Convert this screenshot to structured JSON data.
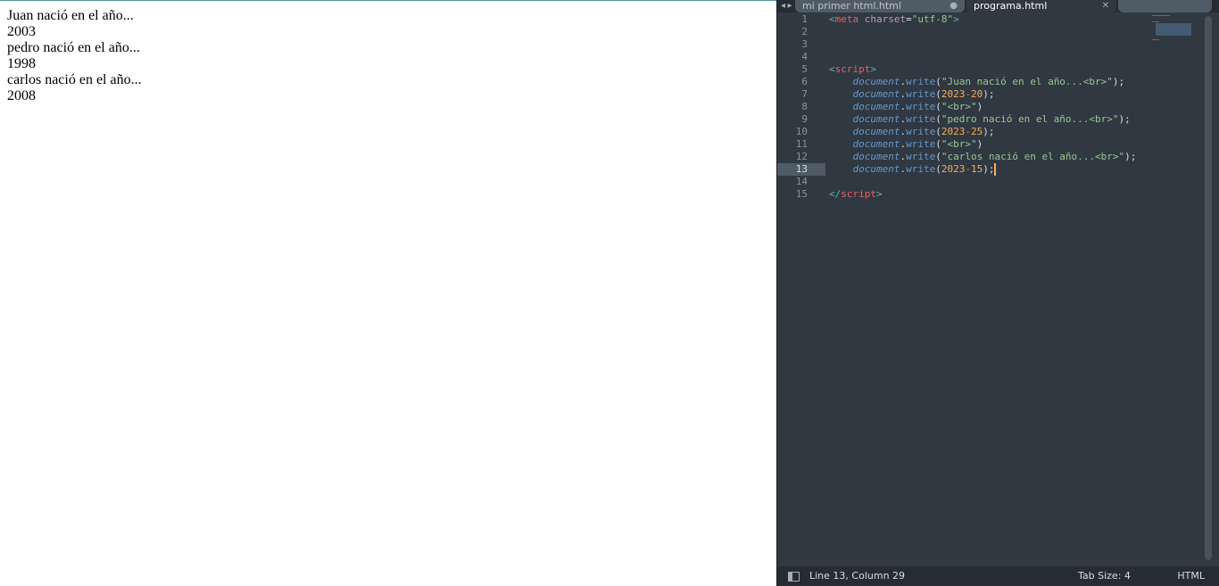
{
  "output_lines": [
    "Juan nació en el año...",
    "2003",
    "pedro nació en el año...",
    "1998",
    "carlos nació en el año...",
    "2008"
  ],
  "editor": {
    "tabs": [
      {
        "label": "mi primer html.html"
      },
      {
        "label": "programa.html",
        "active": true
      },
      {
        "label": ""
      }
    ],
    "active_line": 13,
    "code": [
      [
        [
          "punc",
          "<"
        ],
        [
          "tag",
          "meta"
        ],
        [
          "p",
          " "
        ],
        [
          "attr",
          "charset"
        ],
        [
          "p",
          "="
        ],
        [
          "str",
          "\"utf-8\""
        ],
        [
          "punc",
          ">"
        ]
      ],
      [],
      [],
      [],
      [
        [
          "punc",
          "<"
        ],
        [
          "tag",
          "script"
        ],
        [
          "punc",
          ">"
        ]
      ],
      [
        [
          "p",
          "    "
        ],
        [
          "obj",
          "document"
        ],
        [
          "p",
          "."
        ],
        [
          "fn",
          "write"
        ],
        [
          "p",
          "("
        ],
        [
          "str",
          "\"Juan nació en el año...<br>\""
        ],
        [
          "p",
          ");"
        ]
      ],
      [
        [
          "p",
          "    "
        ],
        [
          "obj",
          "document"
        ],
        [
          "p",
          "."
        ],
        [
          "fn",
          "write"
        ],
        [
          "p",
          "("
        ],
        [
          "num",
          "2023"
        ],
        [
          "op",
          "-"
        ],
        [
          "num",
          "20"
        ],
        [
          "p",
          ");"
        ]
      ],
      [
        [
          "p",
          "    "
        ],
        [
          "obj",
          "document"
        ],
        [
          "p",
          "."
        ],
        [
          "fn",
          "write"
        ],
        [
          "p",
          "("
        ],
        [
          "str",
          "\"<br>\""
        ],
        [
          "p",
          ")"
        ]
      ],
      [
        [
          "p",
          "    "
        ],
        [
          "obj",
          "document"
        ],
        [
          "p",
          "."
        ],
        [
          "fn",
          "write"
        ],
        [
          "p",
          "("
        ],
        [
          "str",
          "\"pedro nació en el año...<br>\""
        ],
        [
          "p",
          ");"
        ]
      ],
      [
        [
          "p",
          "    "
        ],
        [
          "obj",
          "document"
        ],
        [
          "p",
          "."
        ],
        [
          "fn",
          "write"
        ],
        [
          "p",
          "("
        ],
        [
          "num",
          "2023"
        ],
        [
          "op",
          "-"
        ],
        [
          "num",
          "25"
        ],
        [
          "p",
          ");"
        ]
      ],
      [
        [
          "p",
          "    "
        ],
        [
          "obj",
          "document"
        ],
        [
          "p",
          "."
        ],
        [
          "fn",
          "write"
        ],
        [
          "p",
          "("
        ],
        [
          "str",
          "\"<br>\""
        ],
        [
          "p",
          ")"
        ]
      ],
      [
        [
          "p",
          "    "
        ],
        [
          "obj",
          "document"
        ],
        [
          "p",
          "."
        ],
        [
          "fn",
          "write"
        ],
        [
          "p",
          "("
        ],
        [
          "str",
          "\"carlos nació en el año...<br>\""
        ],
        [
          "p",
          ");"
        ]
      ],
      [
        [
          "p",
          "    "
        ],
        [
          "obj",
          "document"
        ],
        [
          "p",
          "."
        ],
        [
          "fn",
          "write"
        ],
        [
          "p",
          "("
        ],
        [
          "num",
          "2023"
        ],
        [
          "op",
          "-"
        ],
        [
          "num",
          "15"
        ],
        [
          "p",
          ");"
        ]
      ],
      [],
      [
        [
          "punc",
          "</"
        ],
        [
          "tag",
          "script"
        ],
        [
          "punc",
          ">"
        ]
      ]
    ]
  },
  "status": {
    "position": "Line 13, Column 29",
    "tab_size": "Tab Size: 4",
    "syntax": "HTML"
  }
}
